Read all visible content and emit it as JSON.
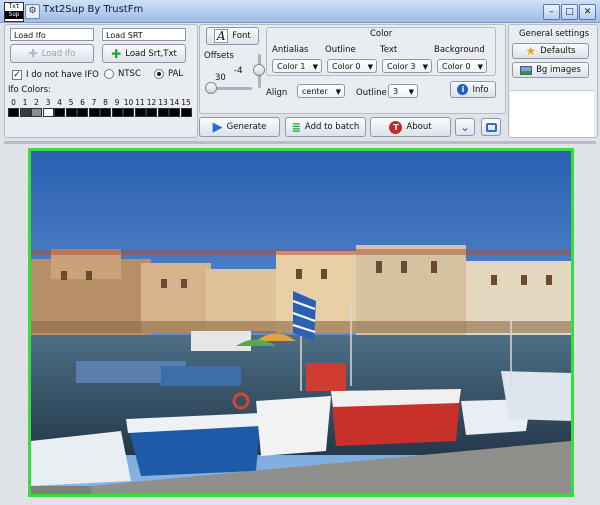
{
  "window": {
    "title": "Txt2Sup By TrustFm",
    "logo_top": "Txt",
    "logo_bottom": "Sup"
  },
  "left_panel": {
    "ifo_field": "Load Ifo",
    "srt_field": "Load SRT",
    "load_ifo_button": "Load Ifo",
    "load_srt_button": "Load Srt,Txt",
    "no_ifo_check": "I do not have IFO",
    "ntsc": "NTSC",
    "pal": "PAL",
    "ifo_colors_label": "Ifo Colors:",
    "color_indices": [
      "0",
      "1",
      "2",
      "3",
      "4",
      "5",
      "6",
      "7",
      "8",
      "9",
      "10",
      "11",
      "12",
      "13",
      "14",
      "15"
    ],
    "swatches": [
      "#000000",
      "#3c3c3c",
      "#8c8c8c",
      "#ffffff",
      "#000000",
      "#000000",
      "#000000",
      "#000000",
      "#000000",
      "#000000",
      "#000000",
      "#000000",
      "#000000",
      "#000000",
      "#000000",
      "#000000"
    ]
  },
  "font_panel": {
    "font_button": "Font",
    "offsets_label": "Offsets",
    "offset_x": "30",
    "offset_y": "-4",
    "color_label": "Color",
    "antialias_label": "Antialias",
    "outline_label": "Outline",
    "text_label": "Text",
    "background_label": "Background",
    "antialias_value": "Color 1",
    "outline_value": "Color 0",
    "text_value": "Color 3",
    "background_value": "Color 0",
    "align_label": "Align",
    "align_value": "center",
    "outline_width_label": "Outline",
    "outline_width_value": "3",
    "info_button": "Info"
  },
  "general_panel": {
    "title": "General settings",
    "defaults_button": "Defaults",
    "bg_images_button": "Bg images"
  },
  "actions": {
    "generate": "Generate",
    "add_to_batch": "Add to batch",
    "about": "About"
  },
  "colors": {
    "accent_green": "#35dd3d",
    "title_bar": "#9fbde6"
  }
}
